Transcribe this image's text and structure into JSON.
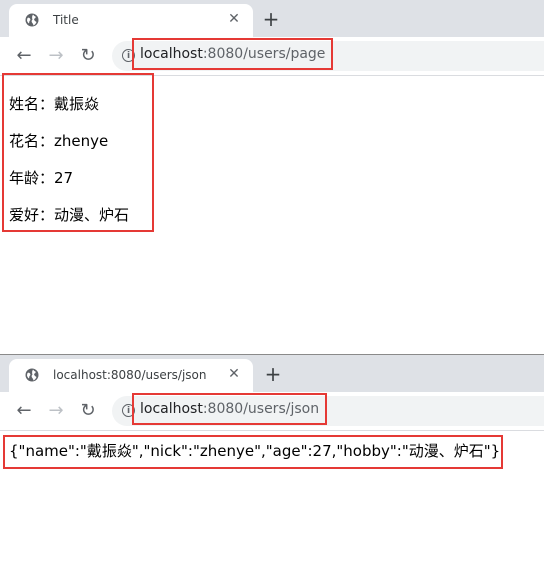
{
  "window1": {
    "tab_title": "Title",
    "close_label": "✕",
    "new_tab_label": "+",
    "back_label": "←",
    "forward_label": "→",
    "reload_label": "↻",
    "info_label": "i",
    "url_host": "localhost",
    "url_rest": ":8080/users/page",
    "fields": [
      {
        "label": "姓名：",
        "value": "戴振焱"
      },
      {
        "label": "花名：",
        "value": "zhenye"
      },
      {
        "label": "年龄：",
        "value": "27"
      },
      {
        "label": "爱好：",
        "value": "动漫、炉石"
      }
    ]
  },
  "window2": {
    "tab_title": "localhost:8080/users/json",
    "close_label": "✕",
    "new_tab_label": "+",
    "back_label": "←",
    "forward_label": "→",
    "reload_label": "↻",
    "info_label": "i",
    "url_host": "localhost",
    "url_rest": ":8080/users/json",
    "json_text": "{\"name\":\"戴振焱\",\"nick\":\"zhenye\",\"age\":27,\"hobby\":\"动漫、炉石\"}"
  },
  "colors": {
    "highlight": "#e53935",
    "tabstrip": "#dee1e6",
    "omnibox": "#f1f3f4"
  },
  "icons": [
    "globe-icon",
    "close-icon",
    "plus-icon",
    "back-arrow-icon",
    "forward-arrow-icon",
    "reload-icon",
    "info-icon"
  ]
}
